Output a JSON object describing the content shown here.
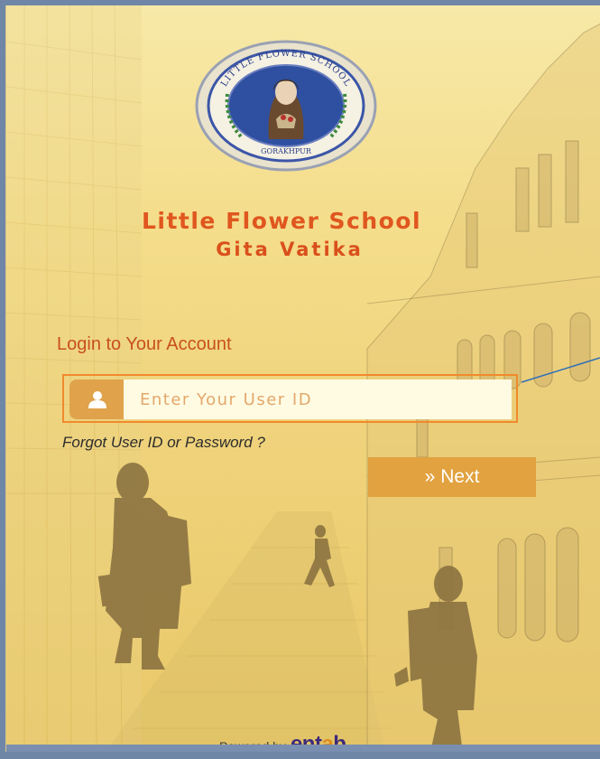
{
  "school": {
    "name": "Little Flower School",
    "branch": "Gita Vatika",
    "logo_text_top": "LITTLE FLOWER SCHOOL",
    "logo_text_bottom": "GORAKHPUR"
  },
  "login": {
    "heading": "Login to Your Account",
    "user_id_placeholder": "Enter Your User ID",
    "user_id_value": "",
    "forgot_link": "Forgot User ID or Password ?",
    "next_button": "Next",
    "next_icon": "»"
  },
  "footer": {
    "powered_by": "Powered by",
    "brand_prefix": "ent",
    "brand_accent": "a",
    "brand_suffix": "b"
  },
  "icons": {
    "user": "user-icon",
    "next": "double-chevron-right-icon"
  },
  "colors": {
    "title_orange": "#e0561f",
    "button_gold": "#e2a23f",
    "input_bg": "#fffbe3",
    "highlight_border": "#f08a2c",
    "callout_blue": "#2f6fb8"
  }
}
